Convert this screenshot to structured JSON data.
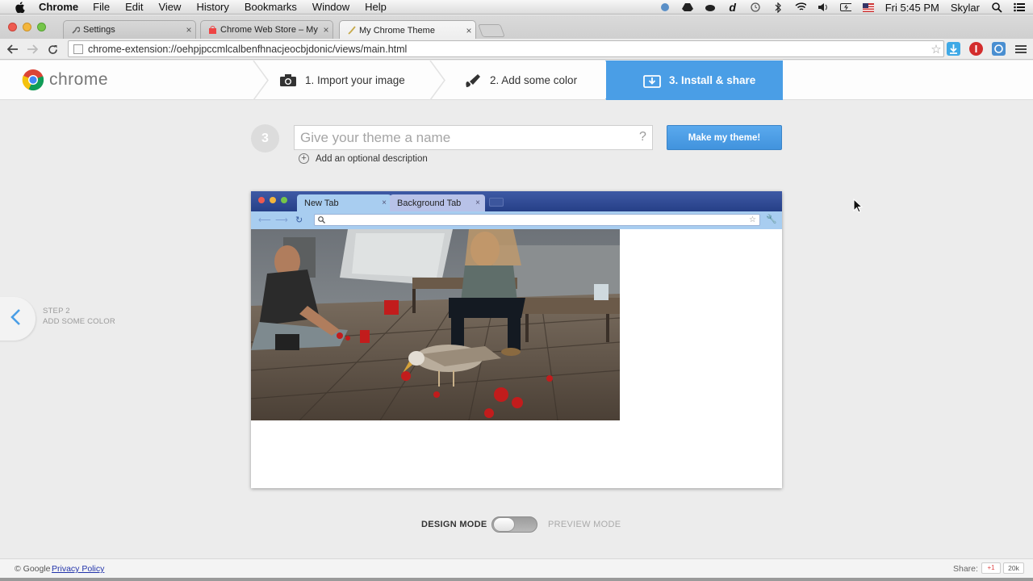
{
  "menubar": {
    "app_name": "Chrome",
    "items": [
      "File",
      "Edit",
      "View",
      "History",
      "Bookmarks",
      "Window",
      "Help"
    ],
    "clock": "Fri 5:45 PM",
    "user": "Skylar"
  },
  "browser": {
    "tabs": [
      {
        "label": "Settings",
        "icon": "wrench-icon"
      },
      {
        "label": "Chrome Web Store – My Ch",
        "icon": "web-store-icon"
      },
      {
        "label": "My Chrome Theme",
        "icon": "brush-icon"
      }
    ],
    "url": "chrome-extension://oehpjpccmlcalbenfhnacjeocbjdonic/views/main.html"
  },
  "header": {
    "logo_text": "chrome",
    "steps": [
      {
        "label": "1. Import your image",
        "icon": "camera-icon"
      },
      {
        "label": "2. Add some color",
        "icon": "paintbrush-icon"
      },
      {
        "label": "3. Install & share",
        "icon": "install-icon"
      }
    ],
    "active_step": 3
  },
  "form": {
    "step_number": "3",
    "name_placeholder": "Give your theme a name",
    "name_value": "",
    "help_glyph": "?",
    "make_button": "Make my theme!",
    "add_description": "Add an optional description"
  },
  "preview": {
    "active_tab": "New Tab",
    "background_tab": "Background Tab"
  },
  "back_step": {
    "line1": "STEP 2",
    "line2": "ADD SOME COLOR"
  },
  "mode": {
    "design_label": "DESIGN MODE",
    "preview_label": "PREVIEW MODE",
    "selected": "design"
  },
  "footer": {
    "copyright": "© Google",
    "privacy_link": "Privacy Policy",
    "share_label": "Share:",
    "gplus_label": "+1",
    "share_count": "20k"
  },
  "colors": {
    "accent": "#4a9ee6",
    "preview_frame": "#263f87",
    "preview_toolbar": "#a8cdf0"
  }
}
